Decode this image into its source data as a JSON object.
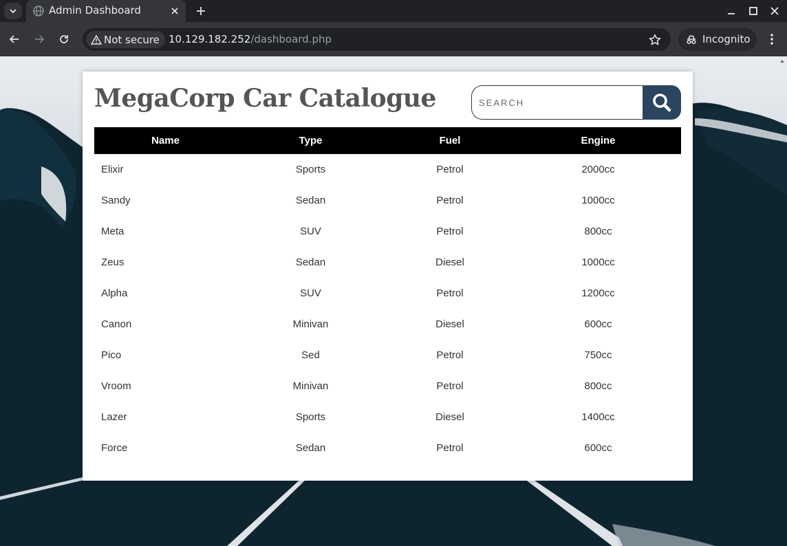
{
  "browser": {
    "tab_title": "Admin Dashboard",
    "security_chip": "Not secure",
    "url_host": "10.129.182.252",
    "url_path": "/dashboard.php",
    "incognito_label": "Incognito",
    "icons": [
      "tab-search-icon",
      "globe-icon",
      "close-icon",
      "plus-icon",
      "minimize-icon",
      "maximize-icon",
      "close-window-icon",
      "back-icon",
      "forward-icon",
      "reload-icon",
      "warning-icon",
      "star-icon",
      "incognito-icon",
      "kebab-menu-icon"
    ]
  },
  "page": {
    "title": "MegaCorp Car Catalogue",
    "search_placeholder": "SEARCH",
    "search_icon": "magnifier-icon",
    "accent_color": "#2b4560"
  },
  "table": {
    "headers": [
      "Name",
      "Type",
      "Fuel",
      "Engine"
    ],
    "rows": [
      [
        "Elixir",
        "Sports",
        "Petrol",
        "2000cc"
      ],
      [
        "Sandy",
        "Sedan",
        "Petrol",
        "1000cc"
      ],
      [
        "Meta",
        "SUV",
        "Petrol",
        "800cc"
      ],
      [
        "Zeus",
        "Sedan",
        "Diesel",
        "1000cc"
      ],
      [
        "Alpha",
        "SUV",
        "Petrol",
        "1200cc"
      ],
      [
        "Canon",
        "Minivan",
        "Diesel",
        "600cc"
      ],
      [
        "Pico",
        "Sed",
        "Petrol",
        "750cc"
      ],
      [
        "Vroom",
        "Minivan",
        "Petrol",
        "800cc"
      ],
      [
        "Lazer",
        "Sports",
        "Diesel",
        "1400cc"
      ],
      [
        "Force",
        "Sedan",
        "Petrol",
        "600cc"
      ]
    ]
  }
}
